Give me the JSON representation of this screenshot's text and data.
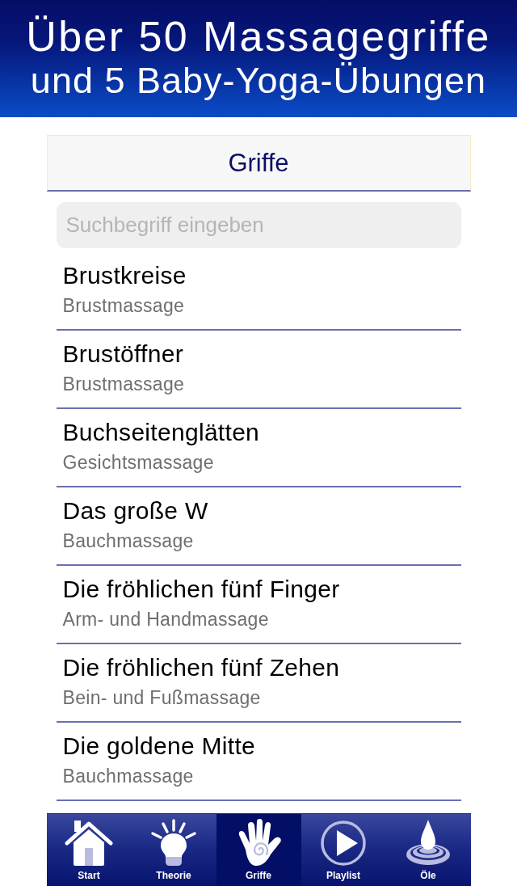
{
  "banner": {
    "lines": [
      "Über 50 Massagegriffe",
      "und 5 Baby-Yoga-Übungen"
    ]
  },
  "navigation_bar": {
    "title": "Griffe"
  },
  "search": {
    "placeholder": "Suchbegriff eingeben"
  },
  "list": [
    {
      "title": "Brustkreise",
      "subtitle": "Brustmassage"
    },
    {
      "title": "Brustöffner",
      "subtitle": "Brustmassage"
    },
    {
      "title": "Buchseitenglätten",
      "subtitle": "Gesichtsmassage"
    },
    {
      "title": "Das große W",
      "subtitle": "Bauchmassage"
    },
    {
      "title": "Die fröhlichen fünf Finger",
      "subtitle": "Arm- und Handmassage"
    },
    {
      "title": "Die fröhlichen fünf Zehen",
      "subtitle": "Bein- und Fußmassage"
    },
    {
      "title": "Die goldene Mitte",
      "subtitle": "Bauchmassage"
    }
  ],
  "tab_bar": [
    {
      "label": "Start",
      "selected": false
    },
    {
      "label": "Theorie",
      "selected": false
    },
    {
      "label": "Griffe",
      "selected": true
    },
    {
      "label": "Playlist",
      "selected": false
    },
    {
      "label": "Öle",
      "selected": false
    }
  ]
}
